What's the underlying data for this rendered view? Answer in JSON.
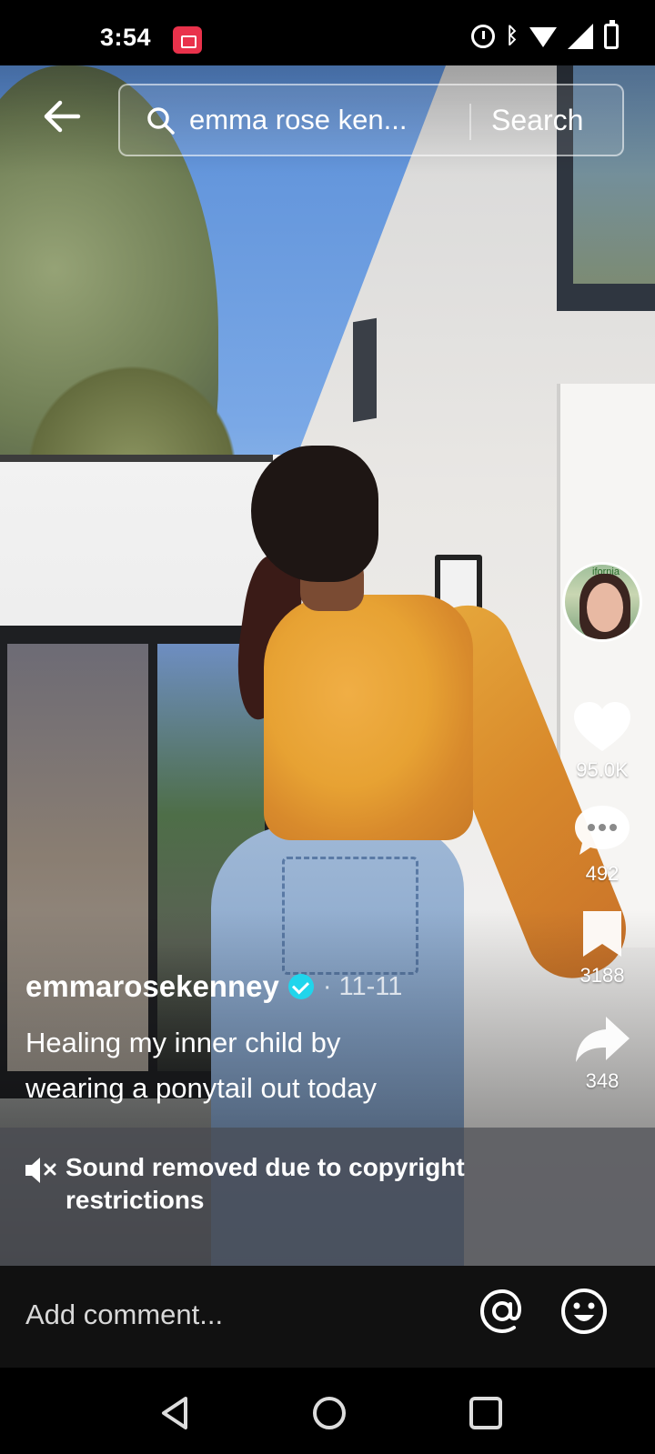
{
  "status_bar": {
    "time": "3:54",
    "icons": [
      "screen-record-icon",
      "alarm-icon",
      "bluetooth-icon",
      "wifi-icon",
      "signal-icon",
      "battery-icon"
    ]
  },
  "search": {
    "query": "emma rose ken...",
    "button_label": "Search"
  },
  "post": {
    "username": "emmarosekenney",
    "date": "· 11-11",
    "caption_line1": "Healing my inner child by",
    "caption_line2": "wearing a ponytail out today"
  },
  "actions": {
    "likes": "95.0K",
    "comments": "492",
    "saves": "3188",
    "shares": "348"
  },
  "avatar_label": "ifornia",
  "sound_notice": {
    "line1": "Sound removed due to copyright",
    "line2": "restrictions"
  },
  "comment_bar": {
    "placeholder": "Add comment..."
  },
  "colors": {
    "accent_record": "#e9324b",
    "verified": "#20d5ec",
    "background": "#000000"
  }
}
